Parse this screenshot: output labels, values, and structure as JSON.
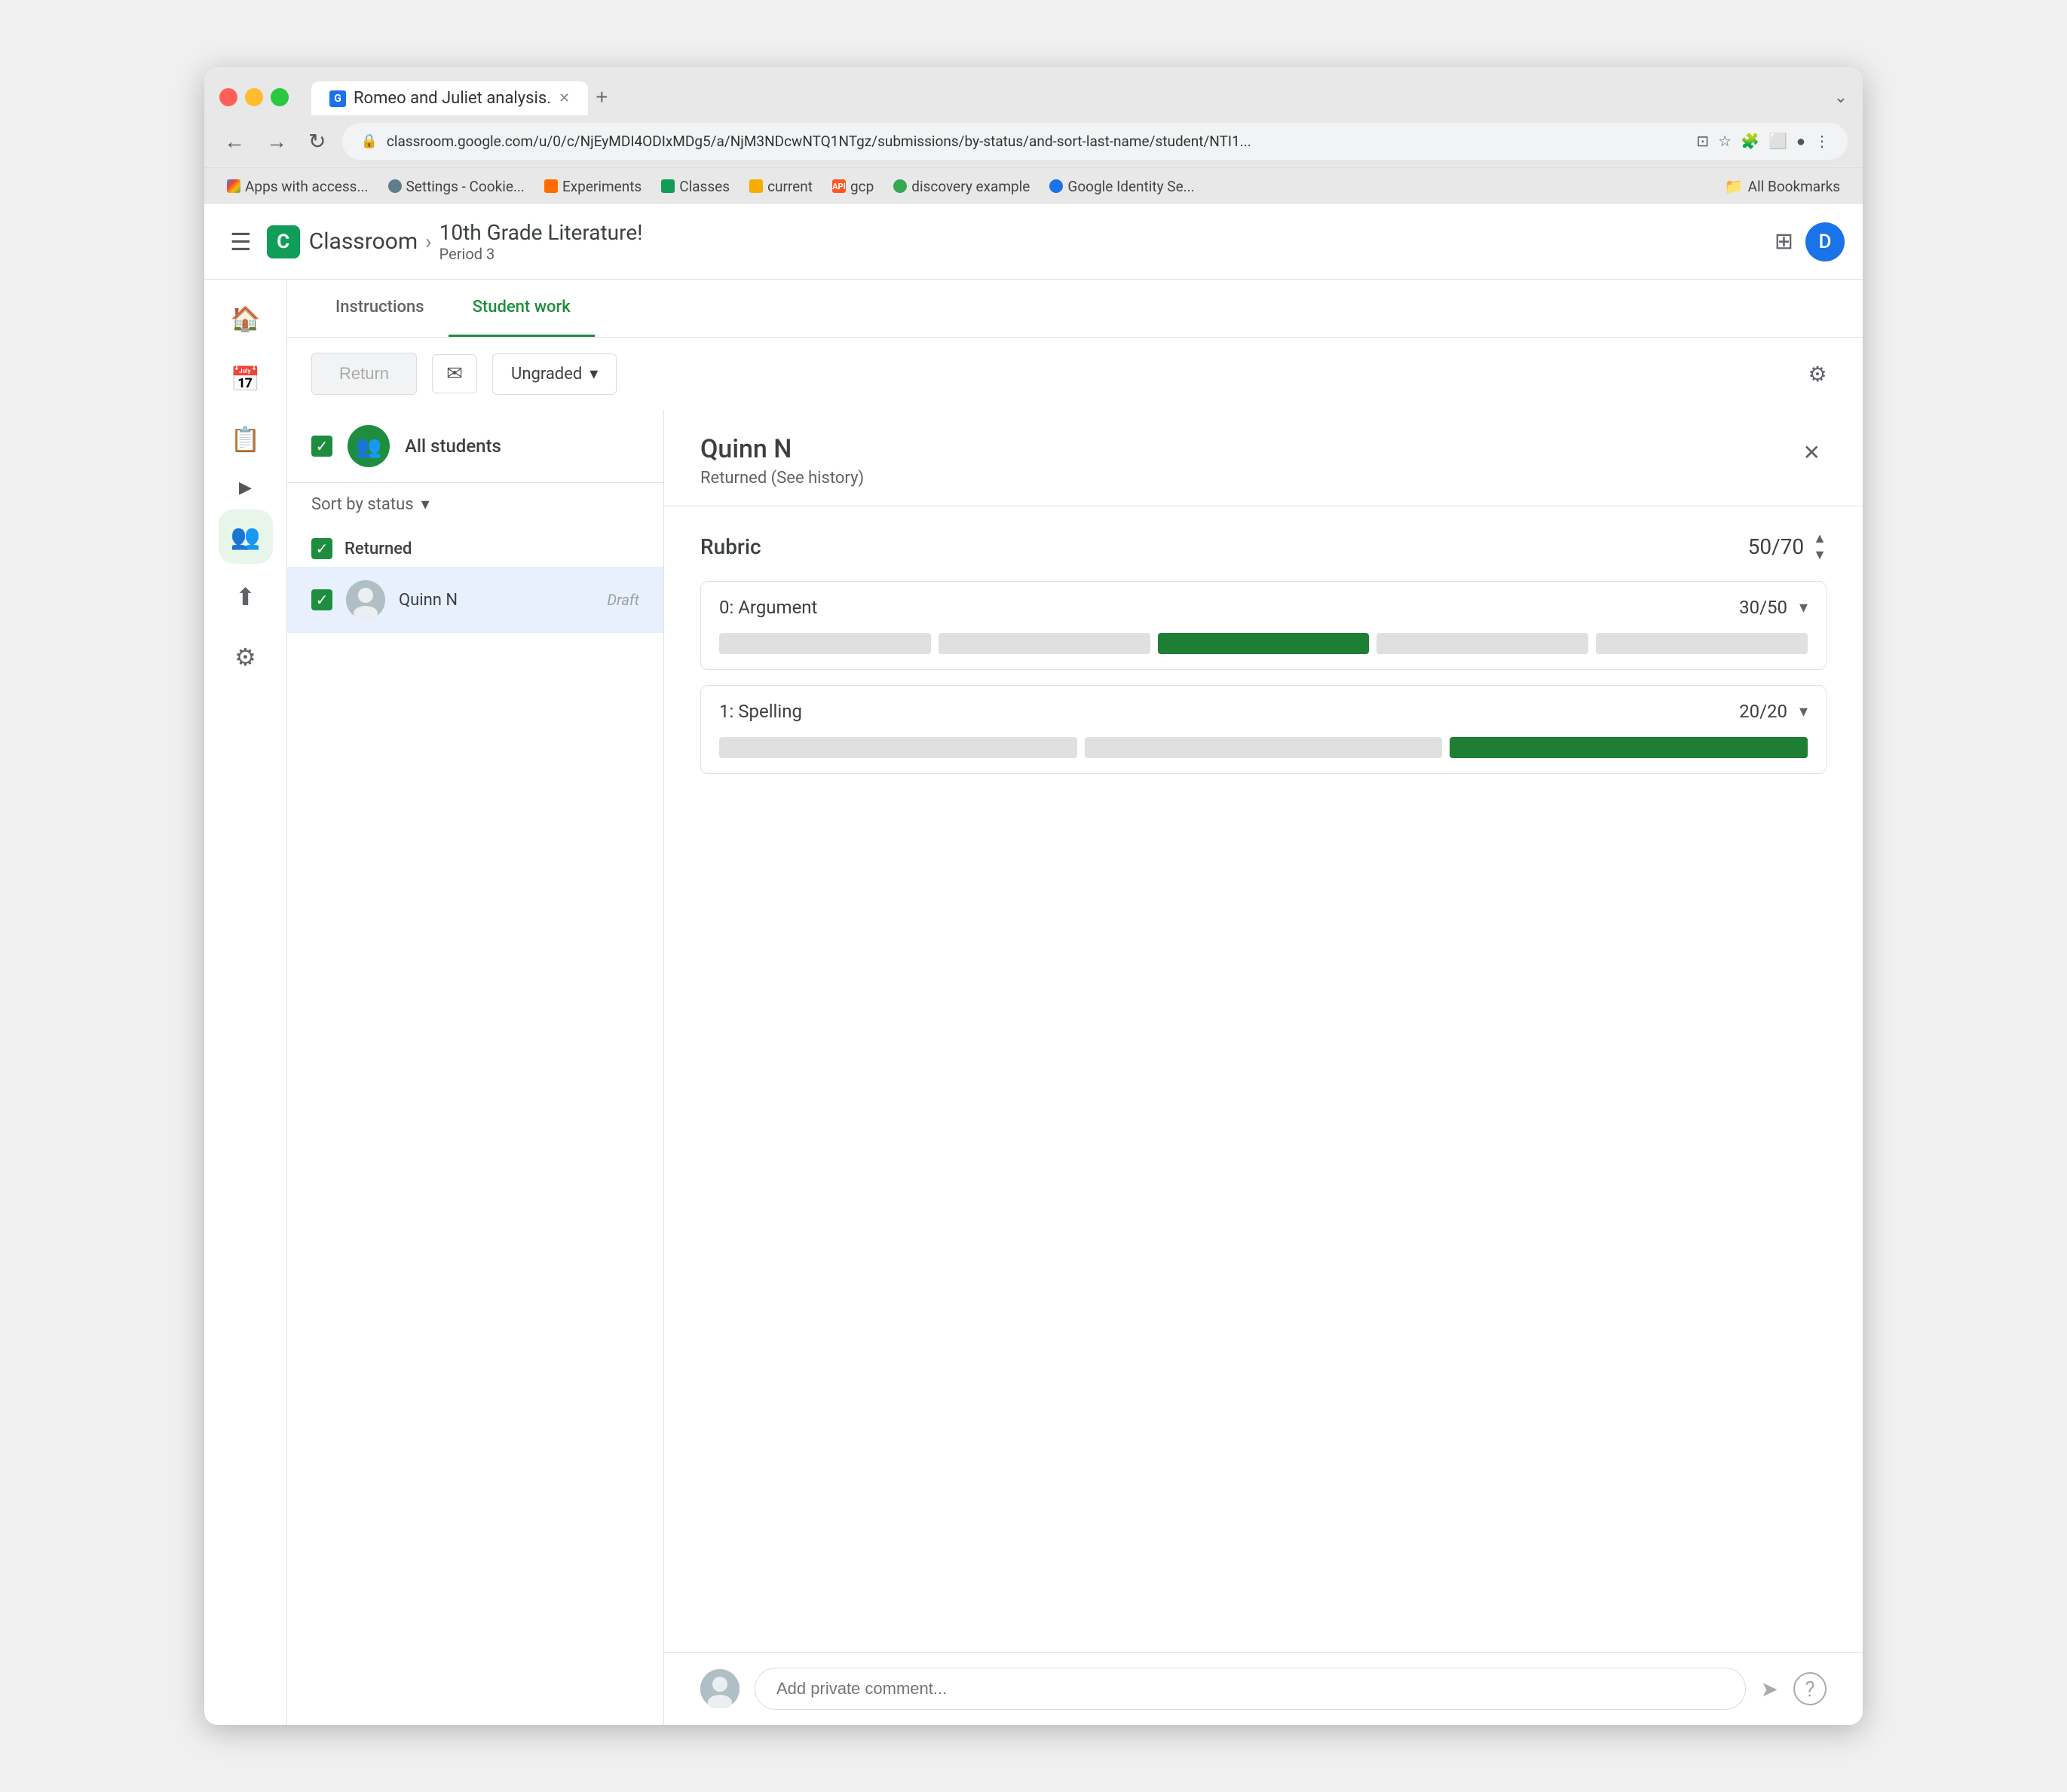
{
  "browser": {
    "tab_title": "Romeo and Juliet analysis.",
    "url": "classroom.google.com/u/0/c/NjEyMDI4ODIxMDg5/a/NjM3NDcwNTQ1NTgz/submissions/by-status/and-sort-last-name/student/NTI1...",
    "new_tab_label": "+",
    "chevron": "›",
    "bookmarks": [
      {
        "label": "Apps with access...",
        "type": "g"
      },
      {
        "label": "Settings - Cookie...",
        "type": "gear"
      },
      {
        "label": "Experiments",
        "type": "exp"
      },
      {
        "label": "Classes",
        "type": "cls"
      },
      {
        "label": "current",
        "type": "folder"
      },
      {
        "label": "gcp",
        "type": "api"
      },
      {
        "label": "discovery example",
        "type": "disc"
      },
      {
        "label": "Google Identity Se...",
        "type": "gid"
      },
      {
        "label": "All Bookmarks",
        "type": "all_folder"
      }
    ]
  },
  "app": {
    "name": "Classroom",
    "class_name": "10th Grade Literature!",
    "class_period": "Period 3",
    "avatar_letter": "D"
  },
  "tabs": [
    {
      "label": "Instructions",
      "active": false
    },
    {
      "label": "Student work",
      "active": true
    }
  ],
  "toolbar": {
    "return_label": "Return",
    "ungraded_label": "Ungraded"
  },
  "all_students": {
    "label": "All students"
  },
  "sort": {
    "label": "Sort by status"
  },
  "groups": [
    {
      "name": "Returned",
      "students": [
        {
          "name": "Quinn N",
          "status": "Draft",
          "selected": true
        }
      ]
    }
  ],
  "detail": {
    "student_name": "Quinn N",
    "student_status": "Returned (See history)",
    "rubric_title": "Rubric",
    "rubric_total_score": "50/70",
    "items": [
      {
        "name": "0: Argument",
        "score": "30/50",
        "bars": [
          {
            "active": false
          },
          {
            "active": false
          },
          {
            "active": true
          },
          {
            "active": false
          },
          {
            "active": false
          }
        ]
      },
      {
        "name": "1: Spelling",
        "score": "20/20",
        "bars": [
          {
            "active": false
          },
          {
            "active": false
          },
          {
            "active": true
          }
        ]
      }
    ]
  },
  "comment": {
    "placeholder": "Add private comment..."
  }
}
